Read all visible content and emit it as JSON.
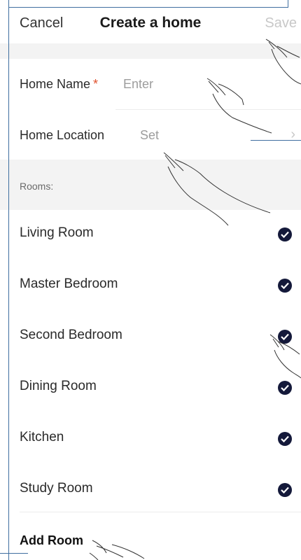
{
  "header": {
    "cancel_label": "Cancel",
    "title": "Create a home",
    "save_label": "Save"
  },
  "form": {
    "home_name_label": "Home Name",
    "home_name_required": "*",
    "home_name_placeholder": "Enter",
    "home_location_label": "Home Location",
    "home_location_value": "Set"
  },
  "rooms": {
    "heading": "Rooms:",
    "items": [
      {
        "label": "Living Room",
        "checked": true
      },
      {
        "label": "Master Bedroom",
        "checked": true
      },
      {
        "label": "Second Bedroom",
        "checked": true
      },
      {
        "label": "Dining Room",
        "checked": true
      },
      {
        "label": "Kitchen",
        "checked": true
      },
      {
        "label": "Study Room",
        "checked": true
      }
    ],
    "add_label": "Add Room"
  },
  "colors": {
    "check_fill": "#14193a",
    "required_star": "#e0502c",
    "disabled_text": "#c8c8c8"
  },
  "icons": {
    "check": "check-circle-icon",
    "chevron": "chevron-right-icon",
    "pointer": "hand-pointer-icon"
  }
}
